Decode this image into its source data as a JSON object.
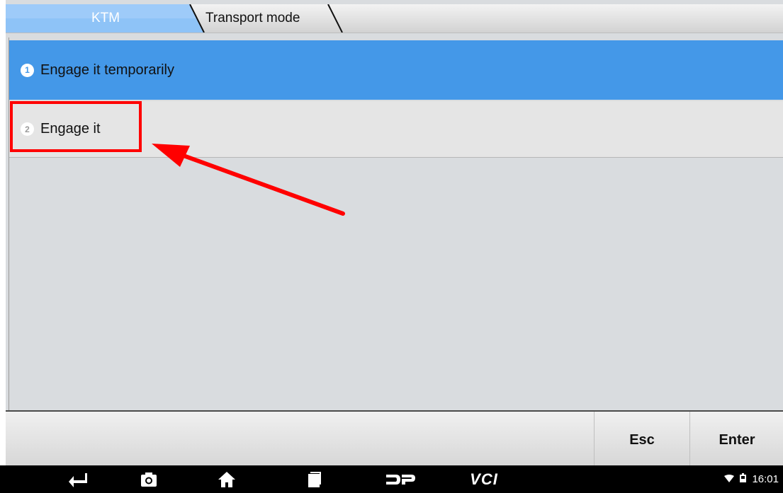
{
  "breadcrumb": {
    "items": [
      {
        "label": "KTM",
        "active": true
      },
      {
        "label": "Transport mode",
        "active": false
      }
    ]
  },
  "menu": {
    "items": [
      {
        "number": "1",
        "label": "Engage it temporarily",
        "selected": true
      },
      {
        "number": "2",
        "label": "Engage it",
        "selected": false
      }
    ]
  },
  "buttons": {
    "esc_label": "Esc",
    "enter_label": "Enter"
  },
  "navbar": {
    "icons": [
      "back-icon",
      "camera-icon",
      "home-icon",
      "recent-apps-icon",
      "dp-logo-icon"
    ],
    "vci_label": "VCI"
  },
  "status": {
    "time": "16:01",
    "icons": [
      "wifi-icon",
      "battery-icon"
    ]
  },
  "colors": {
    "accent": "#4498e8",
    "annotation": "#ff0000"
  }
}
